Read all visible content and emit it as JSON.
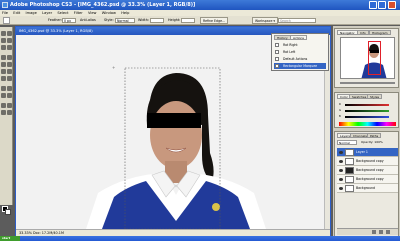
{
  "window": {
    "title": "Adobe Photoshop CS3 - [IMG_4362.psd @ 33.3% (Layer 1, RGB/8)]"
  },
  "menu": [
    "File",
    "Edit",
    "Image",
    "Layer",
    "Select",
    "Filter",
    "View",
    "Window",
    "Help"
  ],
  "options": {
    "feather_label": "Feather:",
    "feather_value": "0 px",
    "antialias_label": "Anti-alias",
    "style_label": "Style:",
    "style_value": "Normal",
    "width_label": "Width:",
    "height_label": "Height:",
    "refine_button": "Refine Edge...",
    "workspace_button": "Workspace ▾",
    "search_placeholder": "Search"
  },
  "document": {
    "tab_title": "IMG_4362.psd @ 33.3% (Layer 1, RGB/8)",
    "status": "33.33%    Doc: 17.2M/40.1M"
  },
  "actions_panel": {
    "tabs": [
      "History",
      "Actions"
    ],
    "rows": [
      {
        "label": "Rot Right",
        "selected": false
      },
      {
        "label": "Rot Left",
        "selected": false
      },
      {
        "label": "Default Actions",
        "selected": false
      },
      {
        "label": "Rectangular Marquee",
        "selected": true
      }
    ]
  },
  "navigator": {
    "tabs": [
      "Navigator",
      "Info",
      "Histogram"
    ],
    "zoom": "33.33%"
  },
  "color_panel": {
    "tabs": [
      "Color",
      "Swatches",
      "Styles"
    ],
    "channels": [
      {
        "label": "R",
        "color": "#e03030"
      },
      {
        "label": "G",
        "color": "#30a030"
      },
      {
        "label": "B",
        "color": "#3050e0"
      }
    ]
  },
  "layers_panel": {
    "tabs": [
      "Layers",
      "Channels",
      "Paths"
    ],
    "blend_mode": "Normal",
    "opacity": "Opacity: 100%",
    "layers": [
      {
        "name": "Layer 1",
        "selected": true
      },
      {
        "name": "Background copy",
        "selected": false
      },
      {
        "name": "Background copy",
        "selected": false
      },
      {
        "name": "Background copy",
        "selected": false
      },
      {
        "name": "Background",
        "selected": false
      }
    ]
  },
  "taskbar": {
    "start": "start"
  },
  "colors": {
    "accent": "#3465c4",
    "photo_bg": "#f2f2f2",
    "uniform": "#213a9a"
  }
}
